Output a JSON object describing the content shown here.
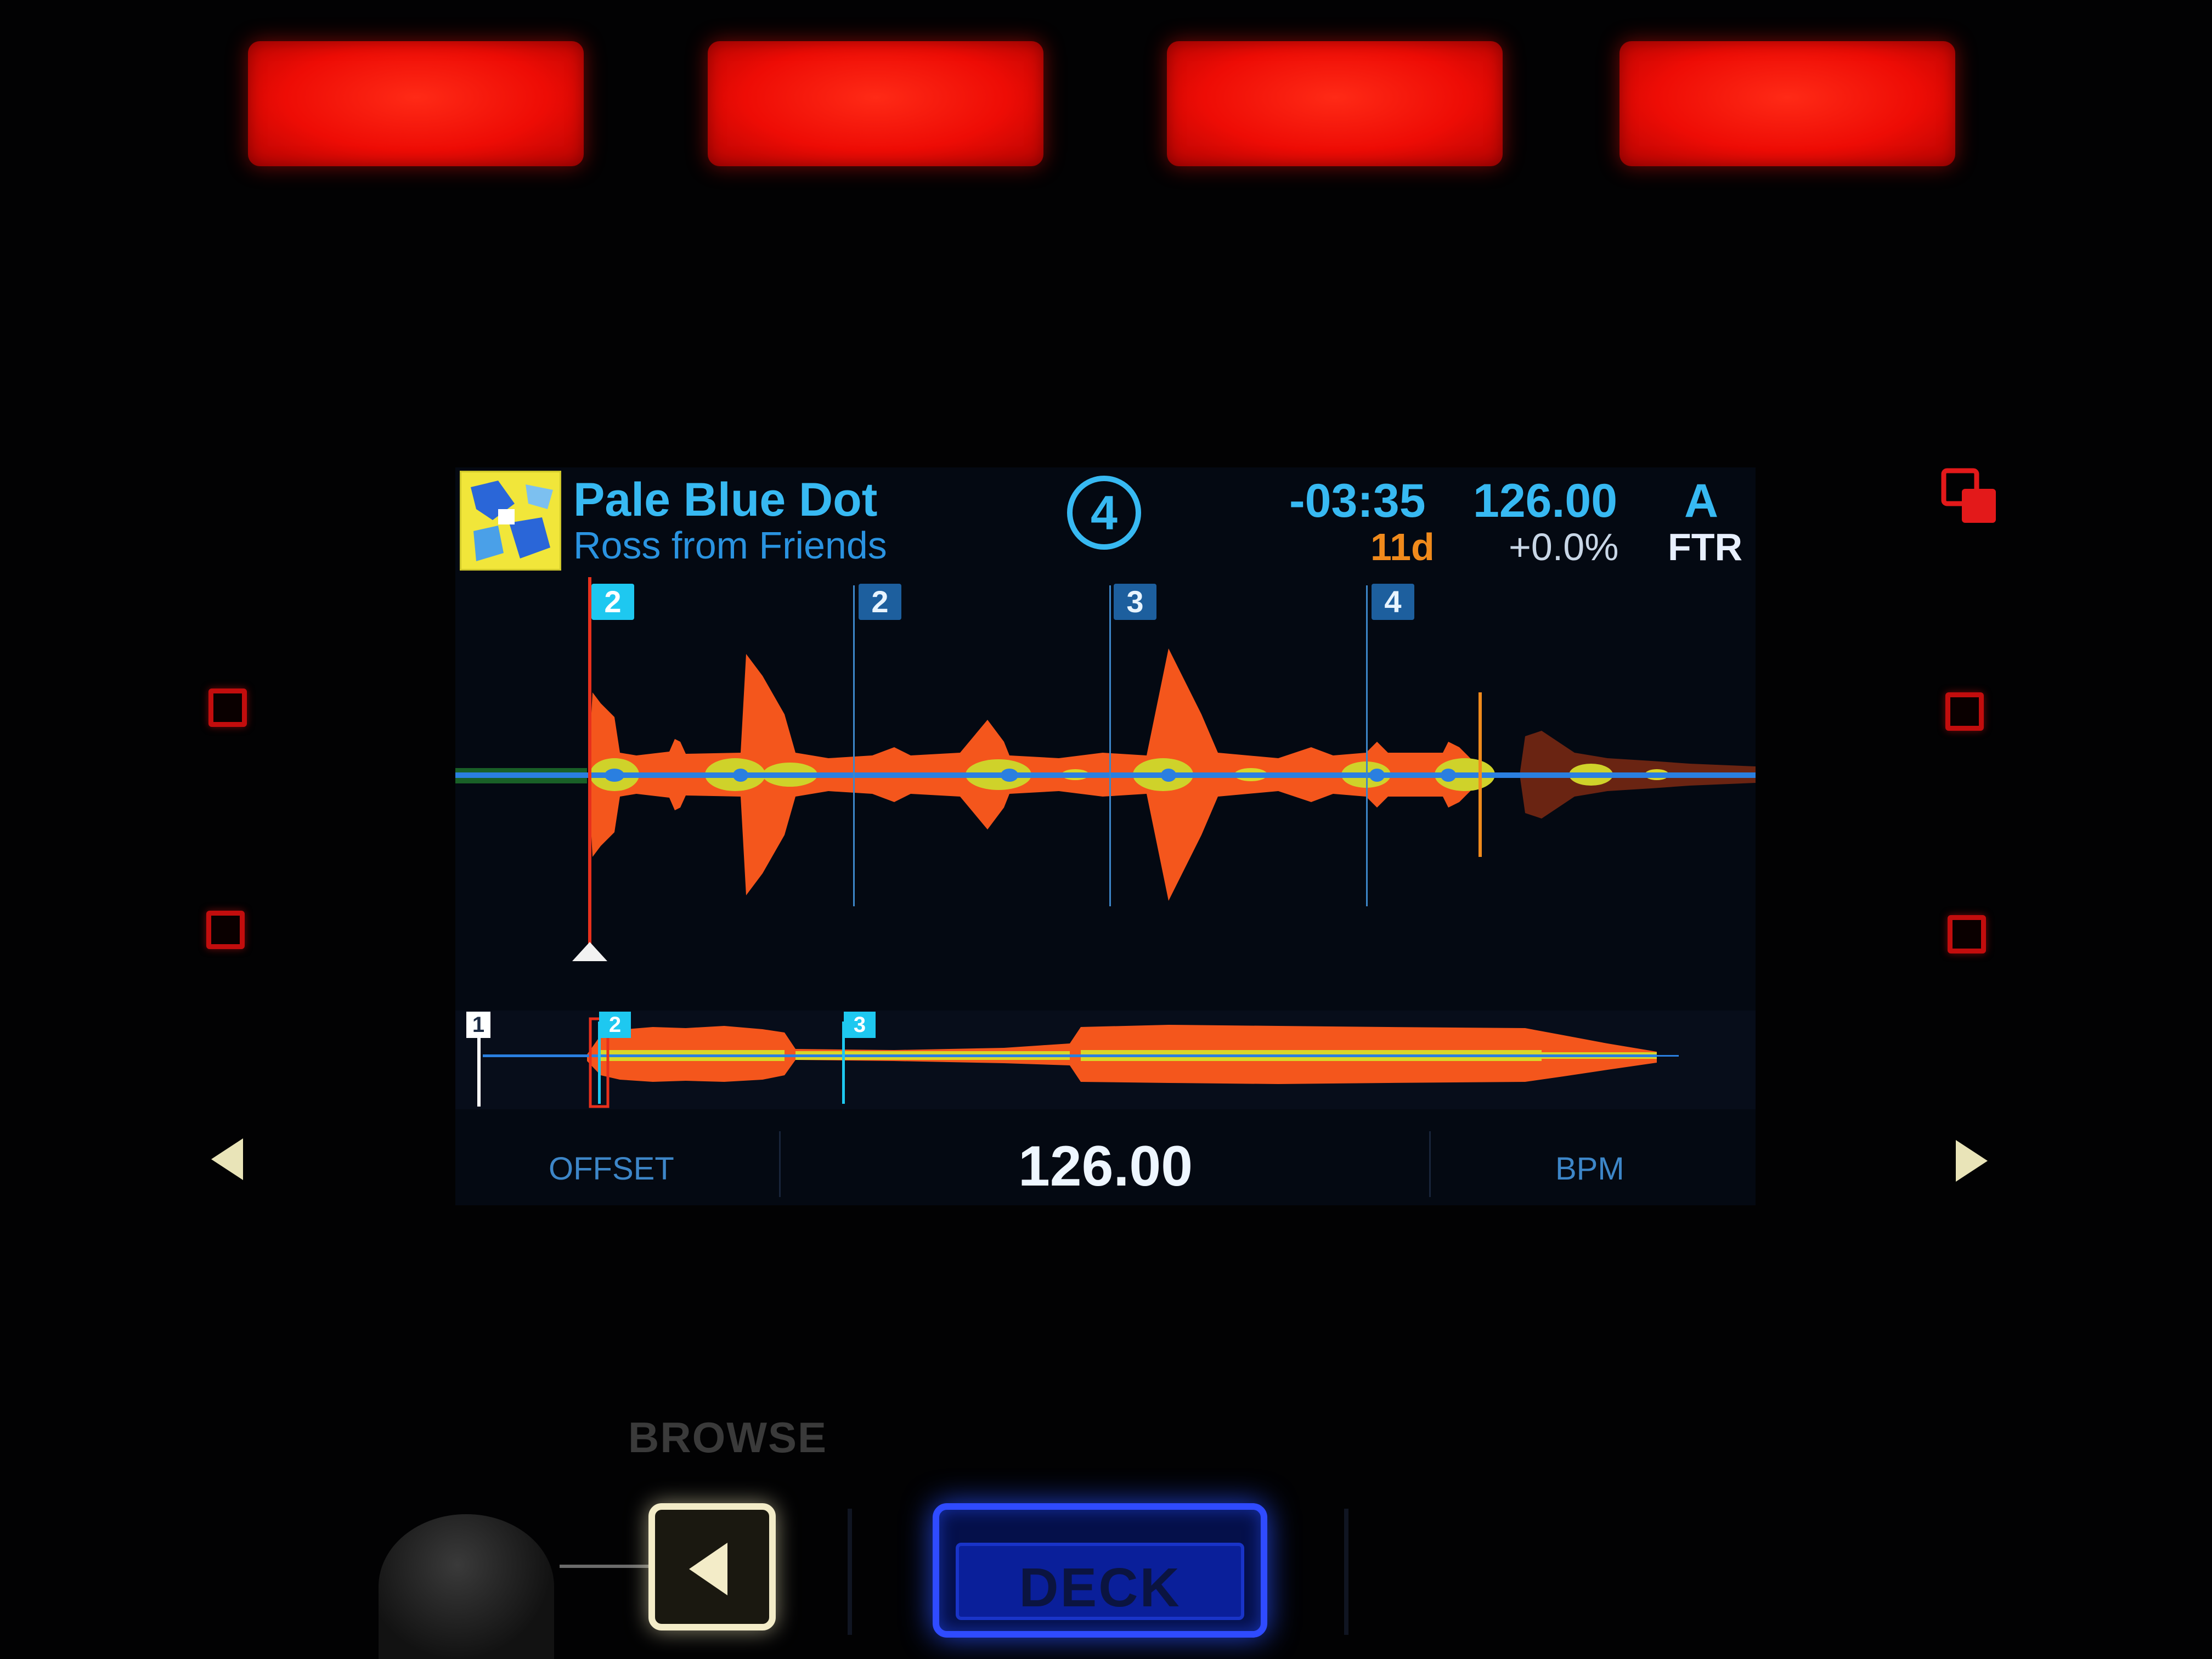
{
  "track": {
    "title": "Pale Blue Dot",
    "artist": "Ross from Friends",
    "deck_number": "4",
    "remaining_time": "-03:35",
    "key": "11d",
    "bpm": "126.00",
    "tempo_offset": "+0.0%",
    "deck_letter": "A",
    "sync_mode": "FTR"
  },
  "beat_markers": [
    "2",
    "2",
    "3",
    "4"
  ],
  "cue_points": [
    "1",
    "2",
    "3"
  ],
  "footer": {
    "left_label": "OFFSET",
    "center_value": "126.00",
    "right_label": "BPM"
  },
  "hardware": {
    "browse_label": "BROWSE",
    "deck_button_label": "DECK"
  },
  "colors": {
    "title_blue": "#37b9f2",
    "key_orange": "#f08a1c",
    "waveform_orange": "#f4561c",
    "waveform_yellow": "#d8d62a",
    "waveform_center_blue": "#2a7fe0",
    "playhead_red": "#e8301c",
    "pad_red": "#ee0c05",
    "deck_blue": "#2f4bff"
  },
  "icons": [
    "album-art-icon",
    "loop-icon",
    "left-arrow-icon",
    "right-arrow-icon",
    "back-arrow-icon"
  ]
}
